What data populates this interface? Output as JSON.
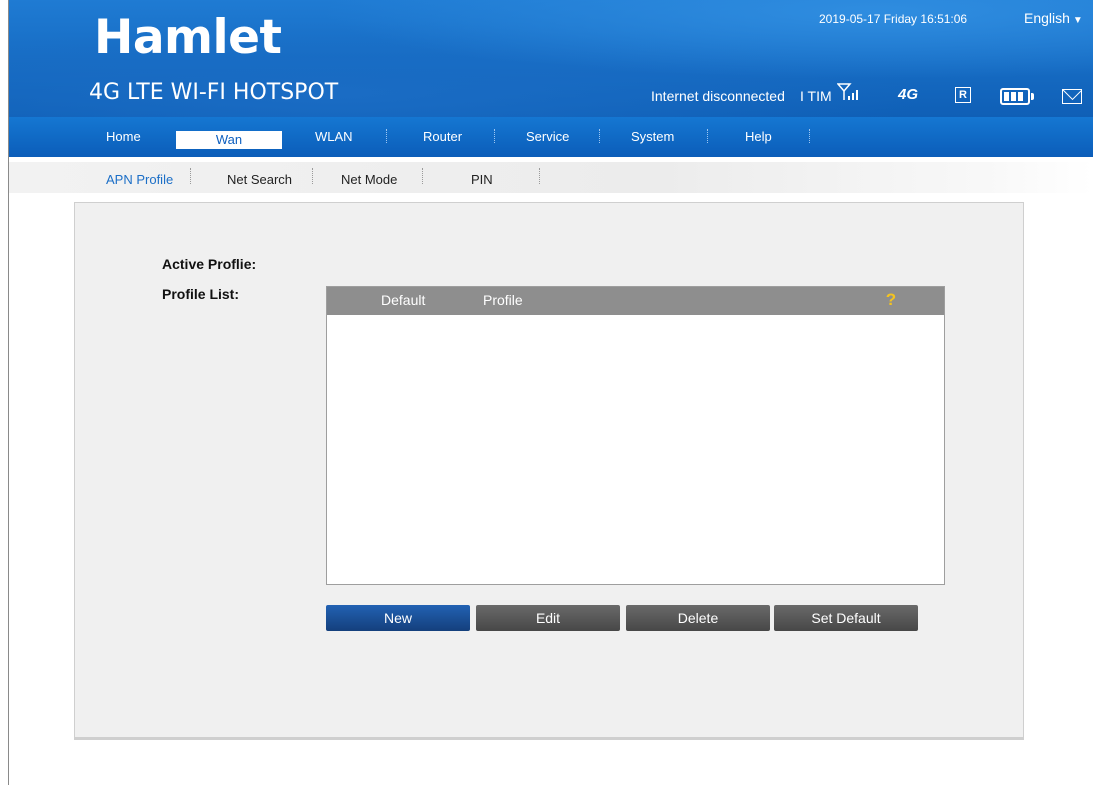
{
  "header": {
    "brand": "Hamlet",
    "subtitle": "4G LTE WI-FI HOTSPOT",
    "datetime": "2019-05-17 Friday 16:51:06",
    "language": "English",
    "connection_status": "Internet disconnected",
    "carrier": "I TIM",
    "network_type": "4G",
    "roaming_label": "R",
    "icons": [
      "signal-icon",
      "network-4g-icon",
      "roaming-icon",
      "battery-icon",
      "mail-icon"
    ]
  },
  "nav": {
    "items": [
      "Home",
      "Wan",
      "WLAN",
      "Router",
      "Service",
      "System",
      "Help"
    ],
    "active": "Wan"
  },
  "subnav": {
    "items": [
      "APN Profile",
      "Net Search",
      "Net Mode",
      "PIN"
    ],
    "active": "APN Profile"
  },
  "content": {
    "active_profile_label": "Active Proflie:",
    "profile_list_label": "Profile List:",
    "columns": [
      "Default",
      "Profile"
    ],
    "rows": []
  },
  "buttons": {
    "new": "New",
    "edit": "Edit",
    "delete": "Delete",
    "set_default": "Set Default"
  },
  "colors": {
    "header_blue": "#1168c4",
    "accent_blue": "#1c6fc7",
    "help_yellow": "#f3c320",
    "button_gray": "#555555"
  }
}
